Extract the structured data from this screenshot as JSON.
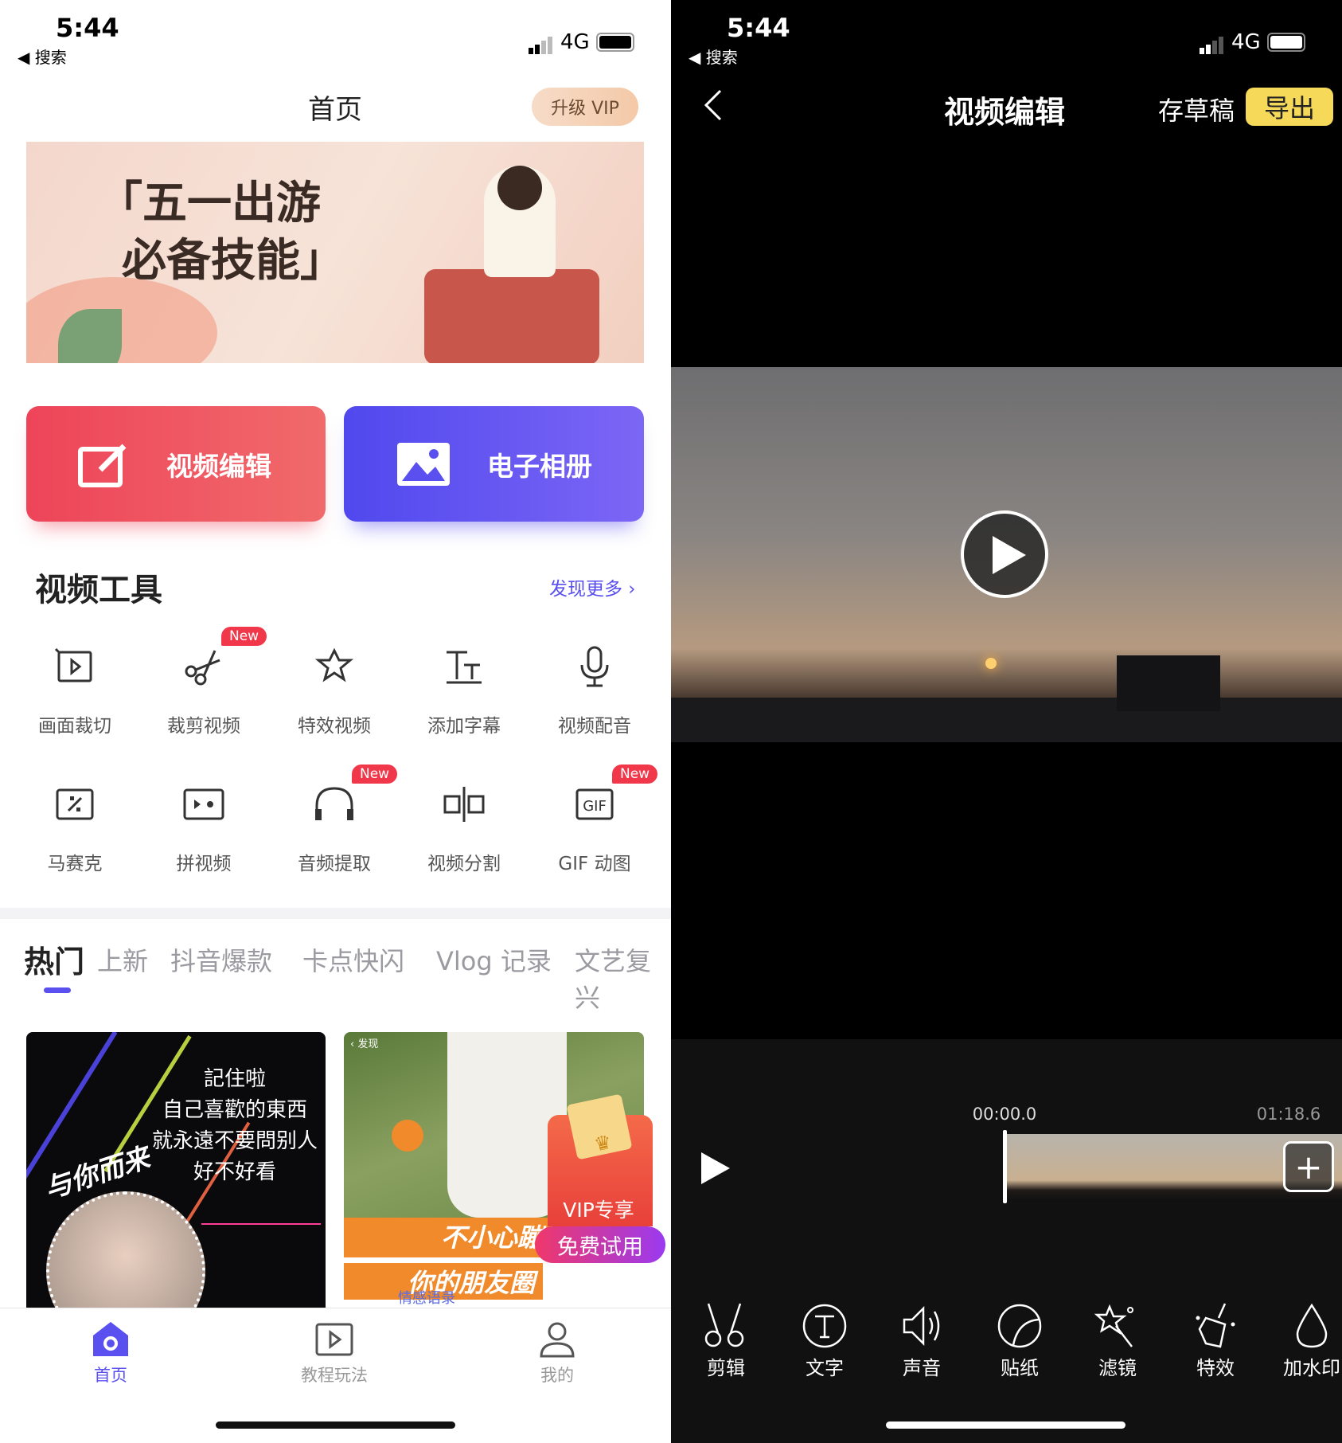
{
  "status": {
    "time": "5:44",
    "back_app": "搜索",
    "network": "4G"
  },
  "home": {
    "title": "首页",
    "vip_button": "升级 VIP",
    "banner": {
      "line1": "「五一出游",
      "line2": "必备技能」"
    },
    "actions": [
      {
        "label": "视频编辑",
        "icon": "edit-icon",
        "color": "#ec4a5c"
      },
      {
        "label": "电子相册",
        "icon": "image-icon",
        "color": "#5a50ef"
      }
    ],
    "tools_title": "视频工具",
    "discover_more": "发现更多",
    "tools": [
      {
        "label": "画面裁切",
        "icon": "crop-icon",
        "badge": ""
      },
      {
        "label": "裁剪视频",
        "icon": "scissors-icon",
        "badge": "New"
      },
      {
        "label": "特效视频",
        "icon": "magic-star-icon",
        "badge": ""
      },
      {
        "label": "添加字幕",
        "icon": "subtitle-icon",
        "badge": ""
      },
      {
        "label": "视频配音",
        "icon": "microphone-icon",
        "badge": ""
      },
      {
        "label": "马赛克",
        "icon": "mosaic-icon",
        "badge": ""
      },
      {
        "label": "拼视频",
        "icon": "merge-video-icon",
        "badge": ""
      },
      {
        "label": "音频提取",
        "icon": "headphones-icon",
        "badge": "New"
      },
      {
        "label": "视频分割",
        "icon": "split-icon",
        "badge": ""
      },
      {
        "label": "GIF 动图",
        "icon": "gif-icon",
        "badge": "New"
      }
    ],
    "tabs": [
      "热门",
      "上新",
      "抖音爆款",
      "卡点快闪",
      "Vlog 记录",
      "文艺复兴"
    ],
    "active_tab": "热门",
    "cards": [
      {
        "lines": [
          "記住啦",
          "自己喜歡的東西",
          "就永遠不要問别人",
          "好不好看"
        ],
        "script": "与你而来"
      },
      {
        "top_label": "发现",
        "caption1": "不小心蹦",
        "caption2": "你的朋友圈",
        "author": "情感语录",
        "vip_label": "VIP专享",
        "trial": "免费试用"
      }
    ],
    "nav": [
      {
        "label": "首页",
        "icon": "home-icon",
        "active": true
      },
      {
        "label": "教程玩法",
        "icon": "tutorial-icon",
        "active": false
      },
      {
        "label": "我的",
        "icon": "profile-icon",
        "active": false
      }
    ],
    "accent": "#5a50ef"
  },
  "editor": {
    "title": "视频编辑",
    "draft": "存草稿",
    "export": "导出",
    "export_color": "#f7d95a",
    "current_time": "00:00.0",
    "duration": "01:18.6",
    "tools": [
      {
        "label": "剪辑",
        "icon": "scissors-icon"
      },
      {
        "label": "文字",
        "icon": "text-icon"
      },
      {
        "label": "声音",
        "icon": "speaker-icon"
      },
      {
        "label": "贴纸",
        "icon": "sticker-icon"
      },
      {
        "label": "滤镜",
        "icon": "magic-wand-icon"
      },
      {
        "label": "特效",
        "icon": "effects-icon"
      },
      {
        "label": "加水印",
        "icon": "watermark-drop-icon"
      }
    ]
  }
}
